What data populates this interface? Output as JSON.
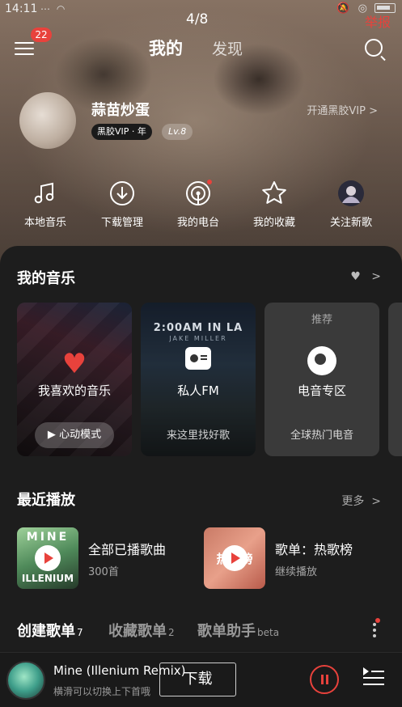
{
  "status_bar": {
    "time": "14:11",
    "page_indicator": "4/8",
    "report_label": "举报"
  },
  "header": {
    "badge_count": "22",
    "tab_mine": "我的",
    "tab_discover": "发现"
  },
  "profile": {
    "username": "蒜苗炒蛋",
    "vip_badge": "黑胶VIP · 年",
    "level": "Lv.8",
    "vip_link": "开通黑胶VIP >"
  },
  "quick_actions": [
    {
      "label": "本地音乐",
      "icon": "music-note-icon"
    },
    {
      "label": "下载管理",
      "icon": "download-icon"
    },
    {
      "label": "我的电台",
      "icon": "radio-podcast-icon"
    },
    {
      "label": "我的收藏",
      "icon": "star-icon"
    },
    {
      "label": "关注新歌",
      "icon": "avatar-icon"
    }
  ],
  "my_music": {
    "title": "我的音乐",
    "cards": [
      {
        "title": "我喜欢的音乐",
        "button": "心动模式"
      },
      {
        "title": "私人FM",
        "subtitle": "来这里找好歌",
        "cover_text": "2:00AM IN LA",
        "cover_sub": "JAKE MILLER"
      },
      {
        "tag": "推荐",
        "title": "电音专区",
        "subtitle": "全球热门电音"
      }
    ]
  },
  "recent": {
    "title": "最近播放",
    "more": "更多",
    "items": [
      {
        "title": "全部已播歌曲",
        "subtitle": "300首",
        "cover_text": "MINE",
        "cover_text2": "ILLENIUM"
      },
      {
        "title": "歌单：热歌榜",
        "subtitle": "继续播放",
        "cover_text": "热歌榜"
      }
    ]
  },
  "playlist_tabs": [
    {
      "label": "创建歌单",
      "count": "7"
    },
    {
      "label": "收藏歌单",
      "count": "2"
    },
    {
      "label": "歌单助手",
      "count": "beta"
    }
  ],
  "player": {
    "title": "Mine (Illenium Remix)",
    "subtitle": "横滑可以切换上下首哦",
    "download_label": "下载"
  },
  "colors": {
    "accent": "#e8423c",
    "sheet_bg": "#1d1d1d"
  }
}
